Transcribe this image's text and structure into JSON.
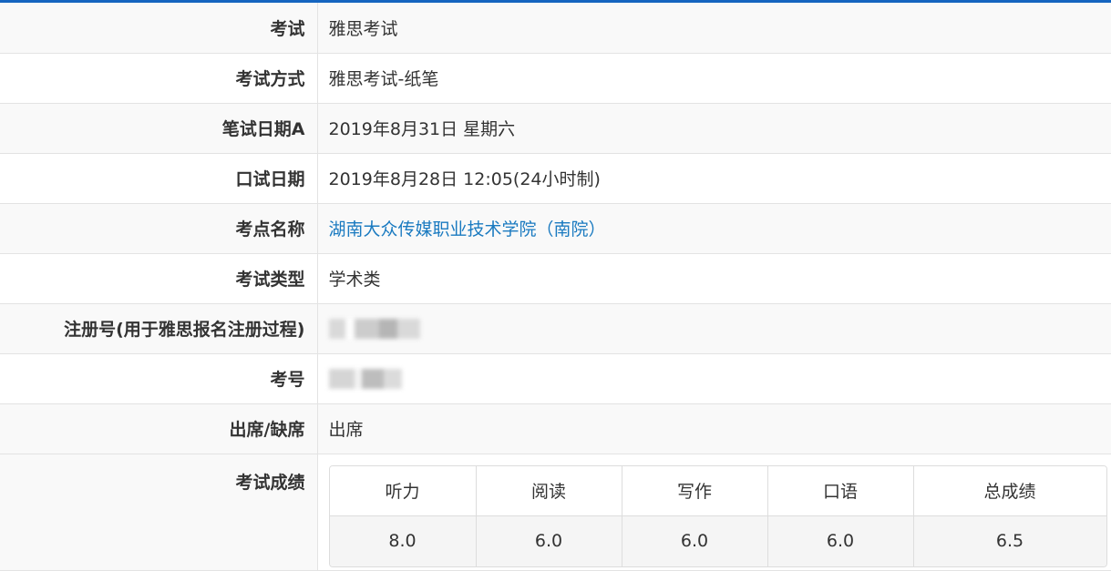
{
  "colors": {
    "accent_bar": "#1565c0",
    "link": "#1a7ac0",
    "row_alt": "#f9f9f9",
    "border": "#e3e3e3"
  },
  "rows": [
    {
      "label": "考试",
      "value": "雅思考试"
    },
    {
      "label": "考试方式",
      "value": "雅思考试-纸笔"
    },
    {
      "label": "笔试日期A",
      "value": "2019年8月31日 星期六"
    },
    {
      "label": "口试日期",
      "value": "2019年8月28日 12:05(24小时制)"
    },
    {
      "label": "考点名称",
      "value": "湖南大众传媒职业技术学院（南院）"
    },
    {
      "label": "考试类型",
      "value": "学术类"
    },
    {
      "label": "注册号(用于雅思报名注册过程)",
      "value": ""
    },
    {
      "label": "考号",
      "value": ""
    },
    {
      "label": "出席/缺席",
      "value": "出席"
    }
  ],
  "scores": {
    "label": "考试成绩",
    "headers": [
      "听力",
      "阅读",
      "写作",
      "口语",
      "总成绩"
    ],
    "values": [
      "8.0",
      "6.0",
      "6.0",
      "6.0",
      "6.5"
    ]
  }
}
